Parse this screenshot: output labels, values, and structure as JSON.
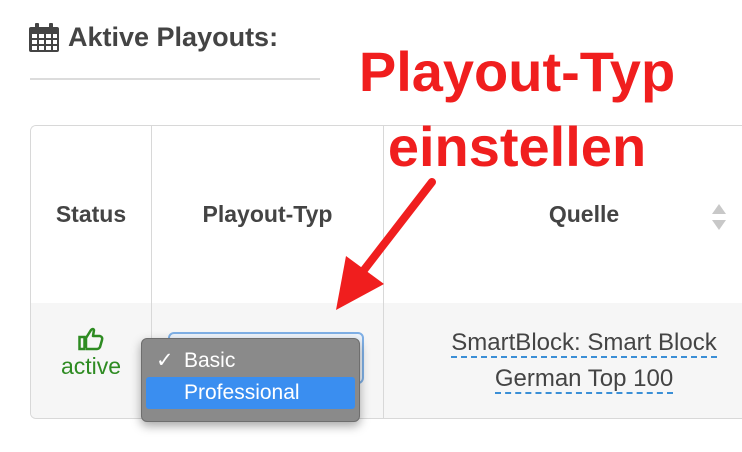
{
  "page": {
    "heading": "Aktive Playouts:",
    "heading_icon": "calendar-icon"
  },
  "annotation": {
    "line1": "Playout-Typ",
    "line2": "einstellen",
    "color": "#f01e1e"
  },
  "table": {
    "headers": {
      "status": "Status",
      "playout_type": "Playout-Typ",
      "source": "Quelle"
    },
    "rows": [
      {
        "status": "active",
        "status_icon": "thumbs-up-icon",
        "source_line1": "SmartBlock: Smart Block",
        "source_line2": "German Top 100"
      }
    ]
  },
  "dropdown": {
    "options": [
      {
        "label": "Basic",
        "checked": true
      },
      {
        "label": "Professional",
        "highlighted": true
      }
    ],
    "check_mark": "✓"
  },
  "colors": {
    "status_green": "#2e8b22",
    "highlight_blue": "#3a8ef0",
    "link_dash": "#3b8fd6"
  }
}
